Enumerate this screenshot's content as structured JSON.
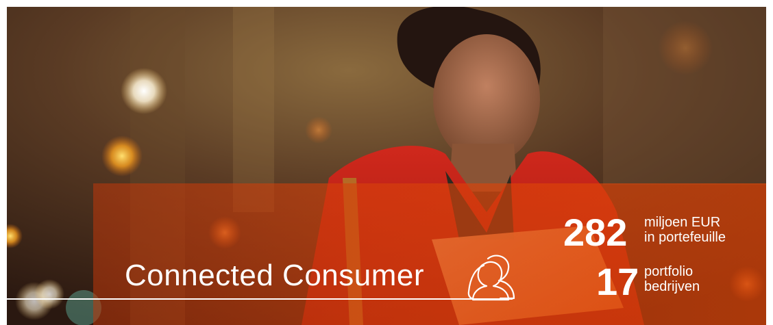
{
  "banner": {
    "title": "Connected Consumer",
    "title_icon": "two-persons-outline-icon",
    "accent_color": "#d9440f",
    "stats": [
      {
        "number": "282",
        "label_line1": "miljoen EUR",
        "label_line2": "in portefeuille"
      },
      {
        "number": "17",
        "label_line1": "portfolio",
        "label_line2": "bedrijven"
      }
    ]
  }
}
